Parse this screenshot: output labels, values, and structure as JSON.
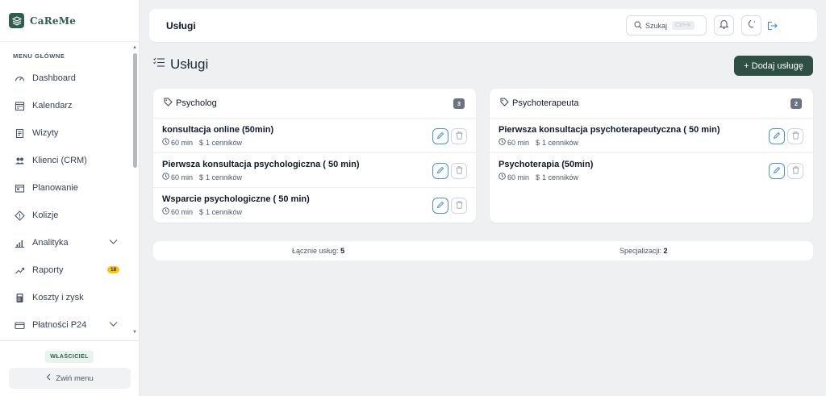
{
  "brand": {
    "name": "CaReMe"
  },
  "sidebar": {
    "menu_title": "MENU GŁÓWNE",
    "items": [
      {
        "label": "Dashboard",
        "icon": "dashboard-gauge-icon"
      },
      {
        "label": "Kalendarz",
        "icon": "calendar-icon"
      },
      {
        "label": "Wizyty",
        "icon": "document-icon"
      },
      {
        "label": "Klienci (CRM)",
        "icon": "users-icon"
      },
      {
        "label": "Planowanie",
        "icon": "planning-icon"
      },
      {
        "label": "Kolizje",
        "icon": "warning-diamond-icon"
      },
      {
        "label": "Analityka",
        "icon": "bar-chart-icon",
        "has_chevron": true
      },
      {
        "label": "Raporty",
        "icon": "trend-icon",
        "badge": "18"
      },
      {
        "label": "Koszty i zysk",
        "icon": "calculator-icon"
      },
      {
        "label": "Płatności P24",
        "icon": "credit-card-icon",
        "has_chevron": true
      }
    ],
    "role": "WŁAŚCICIEL",
    "collapse_label": "Zwiń menu"
  },
  "topbar": {
    "title": "Usługi",
    "search_label": "Szukaj",
    "search_shortcut": "Ctrl+K"
  },
  "page": {
    "title": "Usługi",
    "add_button": "+ Dodaj usługę"
  },
  "cards": [
    {
      "name": "Psycholog",
      "count": "3",
      "services": [
        {
          "name": "konsultacja online (50min)",
          "duration": "60 min",
          "price_lists": "1 cenników"
        },
        {
          "name": "Pierwsza konsultacja psychologiczna ( 50 min)",
          "duration": "60 min",
          "price_lists": "1 cenników"
        },
        {
          "name": "Wsparcie psychologiczne ( 50 min)",
          "duration": "60 min",
          "price_lists": "1 cenników"
        }
      ]
    },
    {
      "name": "Psychoterapeuta",
      "count": "2",
      "services": [
        {
          "name": "Pierwsza konsultacja psychoterapeutyczna ( 50 min)",
          "duration": "60 min",
          "price_lists": "1 cenników"
        },
        {
          "name": "Psychoterapia (50min)",
          "duration": "60 min",
          "price_lists": "1 cenników"
        }
      ]
    }
  ],
  "summary": {
    "total_label": "Łącznie usług:",
    "total_value": "5",
    "spec_label": "Specjalizacji:",
    "spec_value": "2"
  },
  "colors": {
    "brand": "#2f5d50",
    "primary_button": "#2f4f45",
    "edit_accent": "#4a90e2",
    "badge_yellow": "#f5c518"
  }
}
